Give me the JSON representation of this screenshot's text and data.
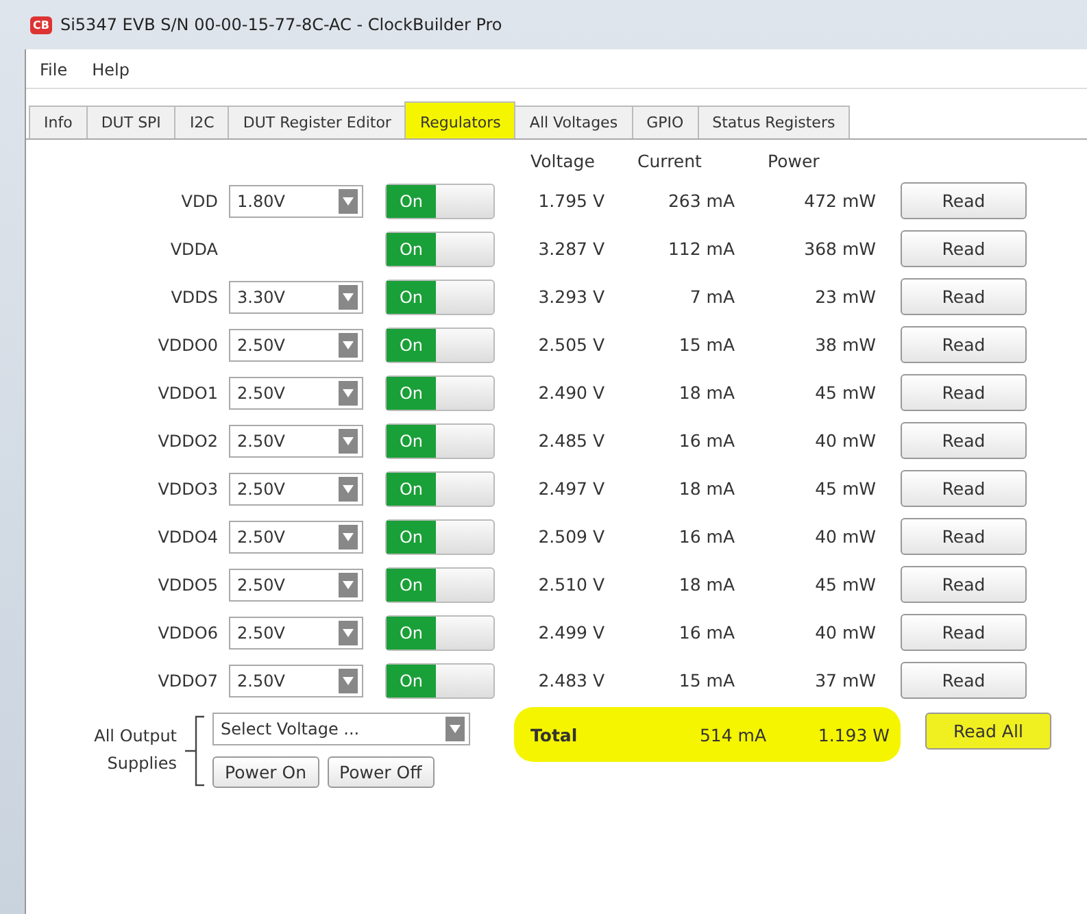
{
  "window": {
    "title": "Si5347 EVB S/N 00-00-15-77-8C-AC - ClockBuilder Pro",
    "app_badge": "CB"
  },
  "menu": [
    "File",
    "Help"
  ],
  "tabs": [
    {
      "label": "Info",
      "selected": false,
      "highlighted": false
    },
    {
      "label": "DUT SPI",
      "selected": false,
      "highlighted": false
    },
    {
      "label": "I2C",
      "selected": false,
      "highlighted": false
    },
    {
      "label": "DUT Register Editor",
      "selected": false,
      "highlighted": false
    },
    {
      "label": "Regulators",
      "selected": true,
      "highlighted": true
    },
    {
      "label": "All Voltages",
      "selected": false,
      "highlighted": false
    },
    {
      "label": "GPIO",
      "selected": false,
      "highlighted": false
    },
    {
      "label": "Status Registers",
      "selected": false,
      "highlighted": false
    }
  ],
  "columns": [
    "Voltage",
    "Current",
    "Power"
  ],
  "regulators": [
    {
      "name": "VDD",
      "setting": "1.80V",
      "switch": "On",
      "on": true,
      "voltage": "1.795 V",
      "current": "263 mA",
      "power": "472 mW",
      "button": "Read"
    },
    {
      "name": "VDDA",
      "switch": "On",
      "on": true,
      "voltage": "3.287 V",
      "current": "112 mA",
      "power": "368 mW",
      "button": "Read"
    },
    {
      "name": "VDDS",
      "setting": "3.30V",
      "switch": "On",
      "on": true,
      "voltage": "3.293 V",
      "current": "7 mA",
      "power": "23 mW",
      "button": "Read"
    },
    {
      "name": "VDDO0",
      "setting": "2.50V",
      "switch": "On",
      "on": true,
      "voltage": "2.505 V",
      "current": "15 mA",
      "power": "38 mW",
      "button": "Read"
    },
    {
      "name": "VDDO1",
      "setting": "2.50V",
      "switch": "On",
      "on": true,
      "voltage": "2.490 V",
      "current": "18 mA",
      "power": "45 mW",
      "button": "Read"
    },
    {
      "name": "VDDO2",
      "setting": "2.50V",
      "switch": "On",
      "on": true,
      "voltage": "2.485 V",
      "current": "16 mA",
      "power": "40 mW",
      "button": "Read"
    },
    {
      "name": "VDDO3",
      "setting": "2.50V",
      "switch": "On",
      "on": true,
      "voltage": "2.497 V",
      "current": "18 mA",
      "power": "45 mW",
      "button": "Read"
    },
    {
      "name": "VDDO4",
      "setting": "2.50V",
      "switch": "On",
      "on": true,
      "voltage": "2.509 V",
      "current": "16 mA",
      "power": "40 mW",
      "button": "Read"
    },
    {
      "name": "VDDO5",
      "setting": "2.50V",
      "switch": "On",
      "on": true,
      "voltage": "2.510 V",
      "current": "18 mA",
      "power": "45 mW",
      "button": "Read"
    },
    {
      "name": "VDDO6",
      "setting": "2.50V",
      "switch": "On",
      "on": true,
      "voltage": "2.499 V",
      "current": "16 mA",
      "power": "40 mW",
      "button": "Read"
    },
    {
      "name": "VDDO7",
      "setting": "2.50V",
      "switch": "On",
      "on": true,
      "voltage": "2.483 V",
      "current": "15 mA",
      "power": "37 mW",
      "button": "Read"
    }
  ],
  "all_outputs": {
    "label": "All Output Supplies",
    "select_placeholder": "Select Voltage ...",
    "buttons": [
      "Power On",
      "Power Off"
    ]
  },
  "total": {
    "label": "Total",
    "current": "514 mA",
    "power": "1.193 W",
    "highlighted": true
  },
  "read_all": {
    "label": "Read All",
    "highlighted": true
  }
}
